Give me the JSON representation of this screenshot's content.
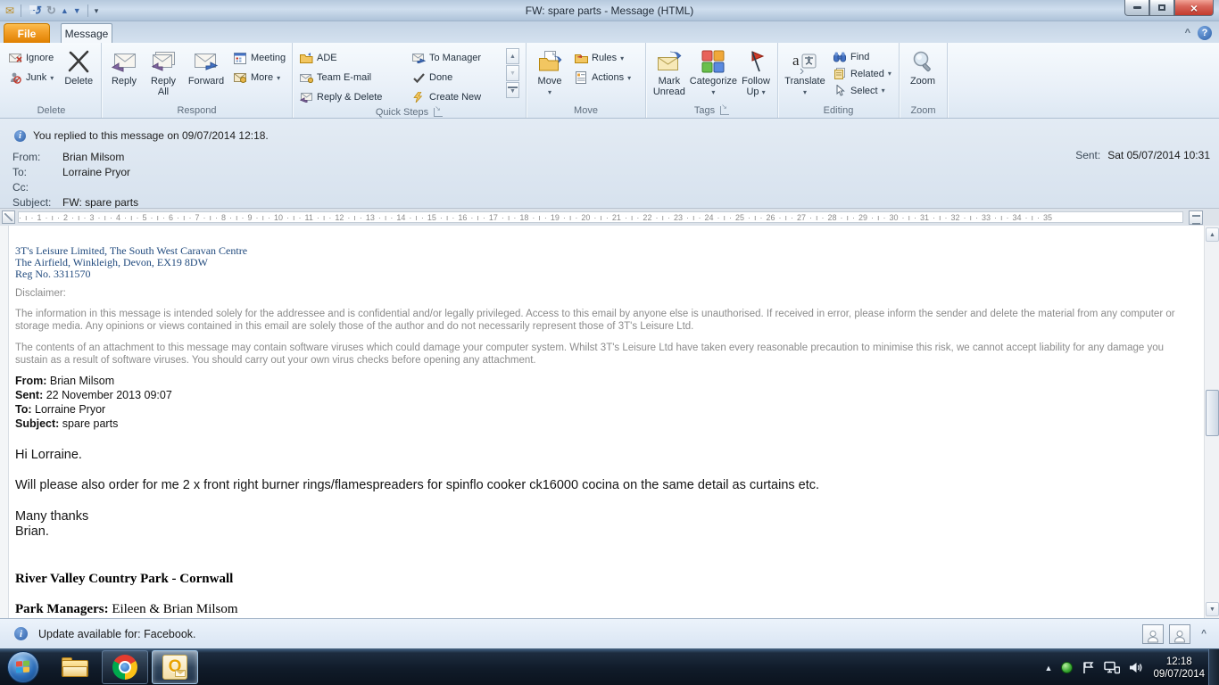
{
  "window": {
    "title": "FW: spare parts  -  Message (HTML)"
  },
  "tabs": {
    "file": "File",
    "message": "Message"
  },
  "ribbon": {
    "delete_group": {
      "label": "Delete",
      "ignore": "Ignore",
      "junk": "Junk",
      "del": "Delete"
    },
    "respond_group": {
      "label": "Respond",
      "reply": "Reply",
      "reply_all_1": "Reply",
      "reply_all_2": "All",
      "forward": "Forward",
      "meeting": "Meeting",
      "more": "More"
    },
    "quick_steps_group": {
      "label": "Quick Steps",
      "items": [
        "ADE",
        "Team E-mail",
        "Reply & Delete",
        "To Manager",
        "Done",
        "Create New"
      ]
    },
    "move_group": {
      "label": "Move",
      "move": "Move",
      "rules": "Rules",
      "actions": "Actions"
    },
    "tags_group": {
      "label": "Tags",
      "mark_unread_1": "Mark",
      "mark_unread_2": "Unread",
      "categorize": "Categorize",
      "follow_up_1": "Follow",
      "follow_up_2": "Up"
    },
    "editing_group": {
      "label": "Editing",
      "translate": "Translate",
      "find": "Find",
      "related": "Related",
      "select": "Select"
    },
    "zoom_group": {
      "label": "Zoom",
      "zoom": "Zoom"
    }
  },
  "header": {
    "infobar": "You replied to this message on 09/07/2014 12:18.",
    "fields": [
      {
        "label": "From:",
        "value": "Brian Milsom"
      },
      {
        "label": "To:",
        "value": "Lorraine Pryor"
      },
      {
        "label": "Cc:",
        "value": ""
      },
      {
        "label": "Subject:",
        "value": "FW: spare parts"
      }
    ],
    "sent_label": "Sent:",
    "sent_value": "Sat 05/07/2014 10:31"
  },
  "ruler": {
    "marks": "· ı · 1 · ı · 2 · ı · 3 · ı · 4 · ı · 5 · ı · 6 · ı · 7 · ı · 8 · ı · 9 · ı · 10 · ı · 11 · ı · 12 · ı · 13 · ı · 14 · ı · 15 · ı · 16 · ı · 17 · ı · 18 · ı · 19 · ı · 20 · ı · 21 · ı · 22 · ı · 23 · ı · 24 · ı · 25 · ı · 26 · ı · 27 · ı · 28 · ı · 29 · ı · 30 · ı · 31 · ı · 32 · ı · 33 · ı · 34 · ı · 35"
  },
  "body": {
    "address_lines": [
      "3T's Leisure Limited, The South West Caravan Centre",
      "The Airfield, Winkleigh, Devon, EX19 8DW",
      "Reg No. 3311570"
    ],
    "disclaimer_title": "Disclaimer:",
    "disclaimer_p1": "The information in this message is intended solely for the addressee and is confidential and/or legally privileged. Access to this email by anyone else is unauthorised. If received in error, please inform the sender and delete the material from any computer or storage media. Any opinions or views contained in this email are solely those of the author and do not necessarily represent those of  3T's Leisure Ltd.",
    "disclaimer_p2": "The contents of an attachment to this message may contain software viruses which could damage your computer system.  Whilst 3T's Leisure Ltd have taken every reasonable precaution to minimise this risk, we cannot accept liability for any damage you sustain as a result of software viruses.  You should carry out your own virus checks before opening any attachment.",
    "quoted_headers": [
      {
        "label": "From:",
        "value": " Brian Milsom"
      },
      {
        "label": "Sent:",
        "value": " 22 November 2013 09:07"
      },
      {
        "label": "To:",
        "value": " Lorraine Pryor"
      },
      {
        "label": "Subject:",
        "value": " spare parts"
      }
    ],
    "greeting": "Hi Lorraine.",
    "request": "Will please also order for me 2 x front right burner rings/flamespreaders for spinflo cooker ck16000 cocina on the same detail as curtains etc.",
    "thanks": "Many thanks",
    "signoff": "Brian.",
    "signature_title": "River Valley Country Park - Cornwall",
    "signature_managers_label": "Park Managers:",
    "signature_managers_value": " Eileen & Brian Milsom"
  },
  "statusbar": {
    "text": "Update available for: Facebook."
  },
  "taskbar": {
    "time": "12:18",
    "date": "09/07/2014"
  },
  "colors": {
    "file_tab_orange": "#E8860C",
    "address_blue": "#1F497D",
    "disclaimer_gray": "#8C8C8C",
    "info_blue": "#2D5FA8",
    "close_red": "#C23B2E"
  }
}
